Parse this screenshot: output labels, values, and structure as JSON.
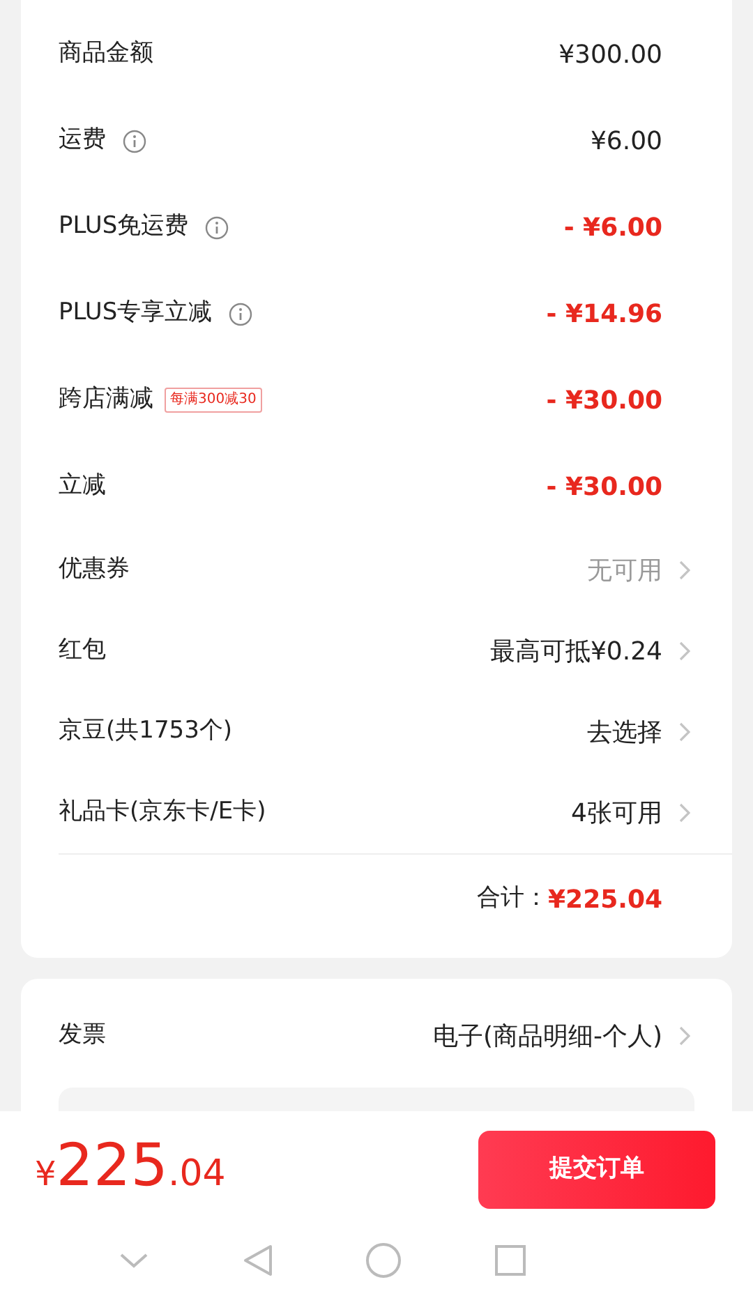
{
  "summary": {
    "rows": [
      {
        "kind": "amount",
        "label": "商品金额",
        "info": false,
        "value": "¥300.00"
      },
      {
        "kind": "amount",
        "label": "运费",
        "info": true,
        "value": "¥6.00"
      },
      {
        "kind": "discount",
        "label": "PLUS免运费",
        "info": true,
        "value": "- ¥6.00"
      },
      {
        "kind": "discount",
        "label": "PLUS专享立减",
        "info": true,
        "value": "- ¥14.96"
      },
      {
        "kind": "discount",
        "label": "跨店满减",
        "info": false,
        "tag": "每满300减30",
        "value": "- ¥30.00"
      },
      {
        "kind": "discount",
        "label": "立减",
        "info": false,
        "value": "- ¥30.00"
      },
      {
        "kind": "link",
        "label": "优惠券",
        "info": false,
        "value": "无可用",
        "disabled": true
      },
      {
        "kind": "link",
        "label": "红包",
        "info": false,
        "value": "最高可抵¥0.24",
        "disabled": false
      },
      {
        "kind": "link",
        "label": "京豆(共1753个)",
        "info": false,
        "value": "去选择",
        "disabled": false
      },
      {
        "kind": "link",
        "label": "礼品卡(京东卡/E卡)",
        "info": false,
        "value": "4张可用",
        "disabled": false
      }
    ],
    "total_label": "合计：",
    "total_value": "¥225.04"
  },
  "invoice": {
    "label": "发票",
    "value": "电子(商品明细-个人)"
  },
  "footer": {
    "currency": "¥",
    "amount_integer": "225",
    "amount_decimal": ".04",
    "submit_button": "提交订单"
  }
}
